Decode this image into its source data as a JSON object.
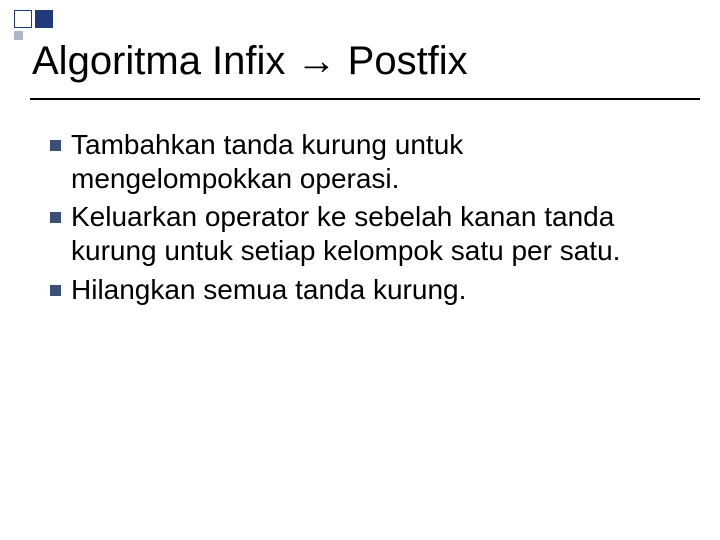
{
  "title": "Algoritma Infix → Postfix",
  "bullets": [
    "Tambahkan tanda kurung untuk mengelompokkan operasi.",
    "Keluarkan operator ke sebelah kanan tanda kurung untuk setiap kelompok satu per satu.",
    "Hilangkan semua tanda kurung."
  ]
}
